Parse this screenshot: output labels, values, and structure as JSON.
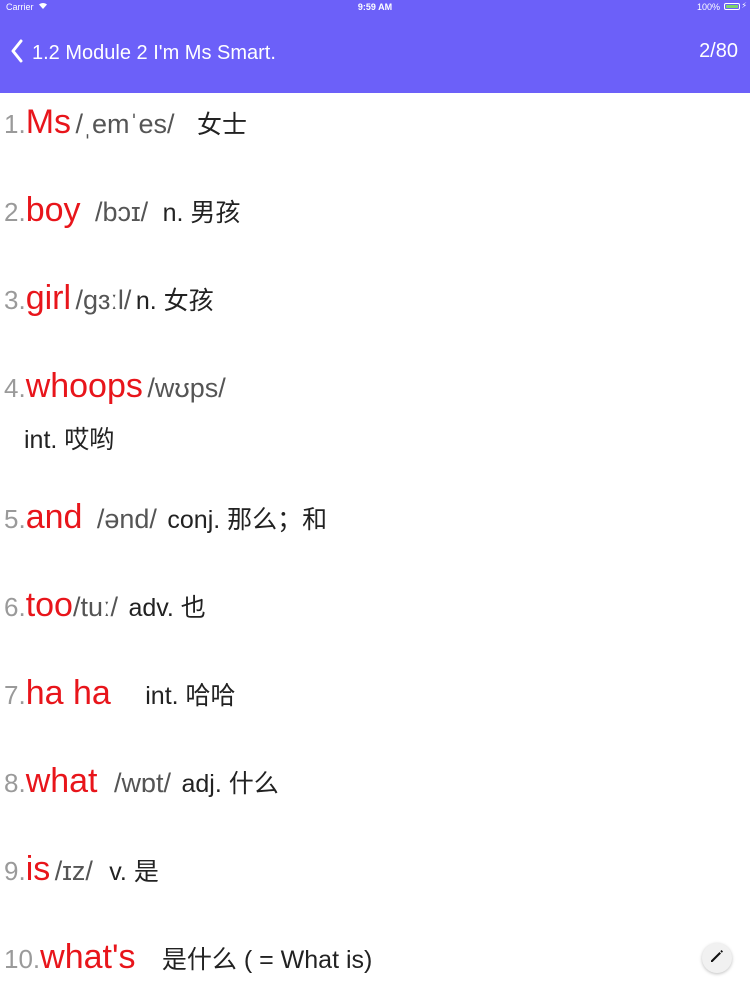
{
  "status_bar": {
    "carrier": "Carrier",
    "time": "9:59 AM",
    "battery": "100%"
  },
  "nav": {
    "back_icon": "chevron-left-icon",
    "title": "1.2 Module 2 I'm Ms Smart.",
    "counter": "2/80"
  },
  "words": [
    {
      "num": "1.",
      "word": "Ms",
      "phonetic": "/ˌemˈes/",
      "meaning": "女士",
      "meaning_line2": ""
    },
    {
      "num": "2.",
      "word": "boy",
      "phonetic": "/bɔɪ/",
      "meaning": "n. 男孩",
      "meaning_line2": ""
    },
    {
      "num": "3.",
      "word": "girl",
      "phonetic": "/gɜːl/",
      "meaning": "n. 女孩",
      "meaning_line2": ""
    },
    {
      "num": "4.",
      "word": "whoops",
      "phonetic": "/wʊps/",
      "meaning": "",
      "meaning_line2": "int. 哎哟"
    },
    {
      "num": "5.",
      "word": "and",
      "phonetic": "/ənd/",
      "meaning": "conj. 那么；和",
      "meaning_line2": ""
    },
    {
      "num": "6.",
      "word": "too",
      "phonetic": "/tuː/",
      "meaning": "adv. 也",
      "meaning_line2": ""
    },
    {
      "num": "7.",
      "word": "ha ha",
      "phonetic": "",
      "meaning": "int. 哈哈",
      "meaning_line2": ""
    },
    {
      "num": "8.",
      "word": "what",
      "phonetic": "/wɒt/",
      "meaning": "adj. 什么",
      "meaning_line2": ""
    },
    {
      "num": "9.",
      "word": "is",
      "phonetic": "/ɪz/",
      "meaning": "v. 是",
      "meaning_line2": ""
    },
    {
      "num": "10.",
      "word": "what's",
      "phonetic": "",
      "meaning": "是什么 ( = What is)",
      "meaning_line2": ""
    }
  ],
  "colors": {
    "nav_background": "#6c60f9",
    "word": "#e8151b",
    "number": "#9a9a9a"
  },
  "edit_icon": "pencil-icon"
}
